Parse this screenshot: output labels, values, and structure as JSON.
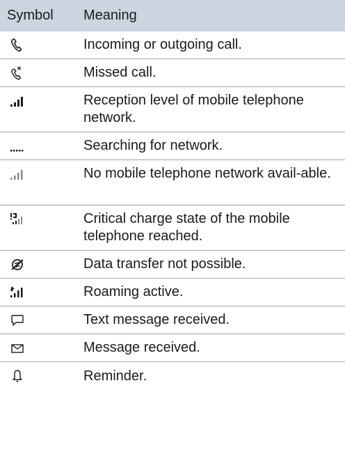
{
  "header": {
    "symbol": "Symbol",
    "meaning": "Meaning"
  },
  "rows": [
    {
      "icon": "phone-call-icon",
      "meaning": "Incoming or outgoing call."
    },
    {
      "icon": "missed-call-icon",
      "meaning": "Missed call."
    },
    {
      "icon": "reception-level-icon",
      "meaning": "Reception level of mobile telephone network."
    },
    {
      "icon": "searching-network-icon",
      "meaning": "Searching for network."
    },
    {
      "icon": "no-network-icon",
      "meaning": "No mobile telephone network avail-able."
    },
    {
      "icon": "critical-charge-icon",
      "meaning": "Critical charge state of the mobile telephone reached."
    },
    {
      "icon": "no-data-transfer-icon",
      "meaning": "Data transfer not possible."
    },
    {
      "icon": "roaming-icon",
      "meaning": "Roaming active."
    },
    {
      "icon": "text-message-icon",
      "meaning": "Text message received."
    },
    {
      "icon": "message-envelope-icon",
      "meaning": "Message received."
    },
    {
      "icon": "reminder-bell-icon",
      "meaning": "Reminder."
    }
  ],
  "colors": {
    "header_bg": "#cbd5df",
    "divider": "#9aa4ad",
    "text": "#1a1a1a"
  }
}
